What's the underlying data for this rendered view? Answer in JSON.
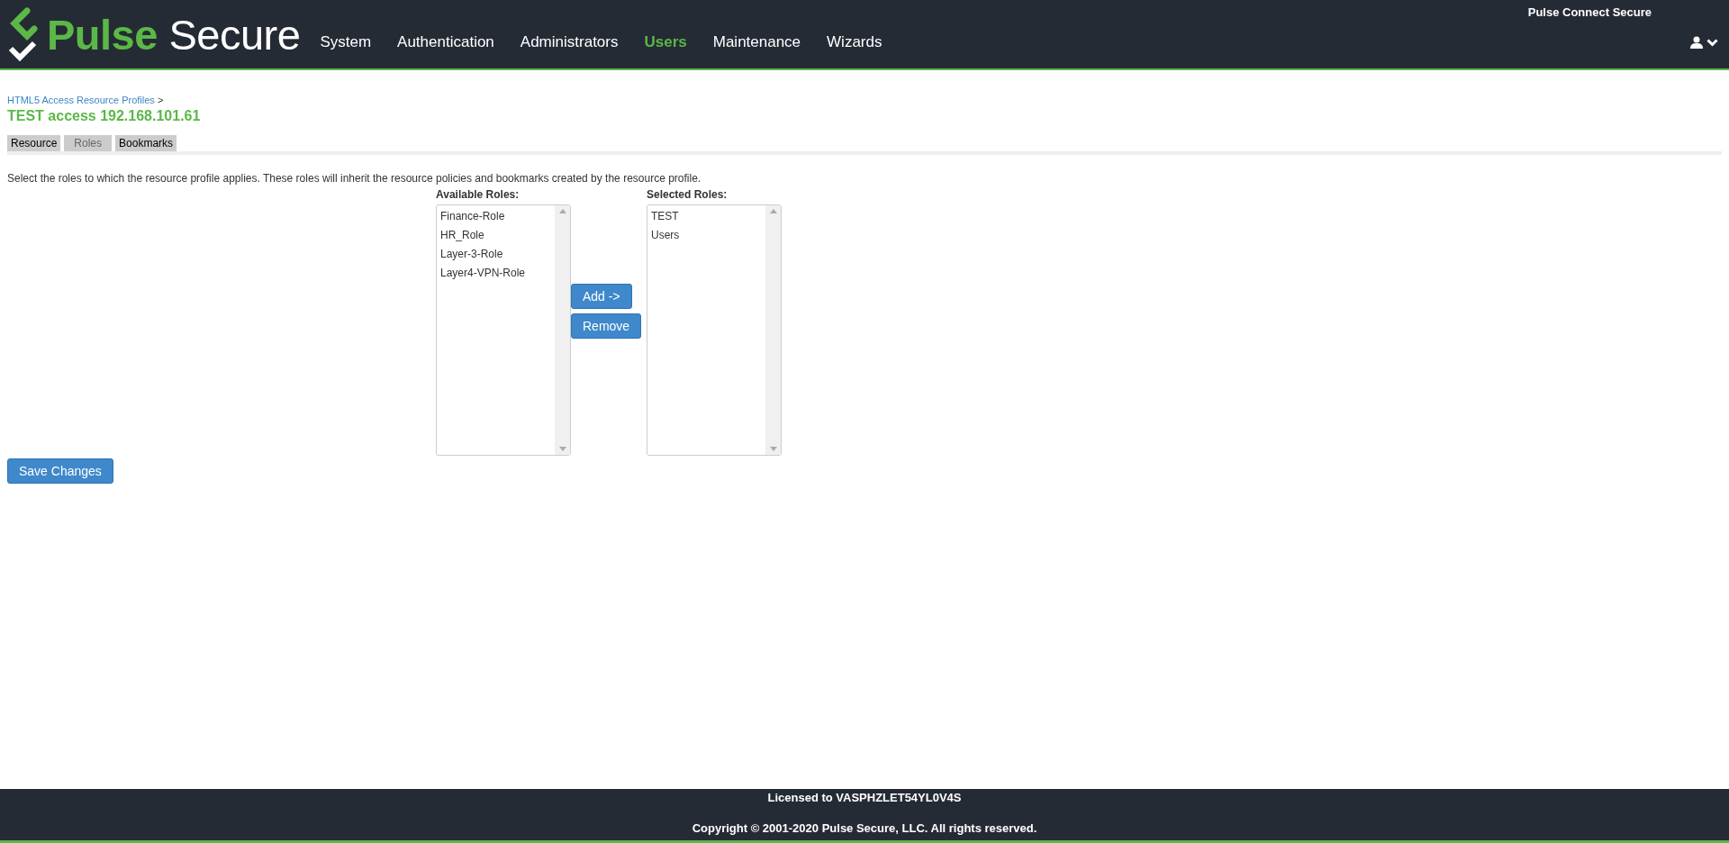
{
  "header": {
    "logo": [
      "Pulse",
      "Secure"
    ],
    "product": "Pulse Connect Secure",
    "nav": [
      {
        "label": "System",
        "selected": false
      },
      {
        "label": "Authentication",
        "selected": false
      },
      {
        "label": "Administrators",
        "selected": false
      },
      {
        "label": "Users",
        "selected": true
      },
      {
        "label": "Maintenance",
        "selected": false
      },
      {
        "label": "Wizards",
        "selected": false
      }
    ]
  },
  "breadcrumb": {
    "link": "HTML5 Access Resource Profiles",
    "separator": ">"
  },
  "title": "TEST access 192.168.101.61",
  "tabs": [
    {
      "label": "Resource",
      "selected": false
    },
    {
      "label": "Roles",
      "selected": true
    },
    {
      "label": "Bookmarks",
      "selected": false
    }
  ],
  "description": "Select the roles to which the resource profile applies. These roles will inherit the resource policies and bookmarks created by the resource profile.",
  "available_roles": {
    "label": "Available Roles:",
    "items": [
      "Finance-Role",
      "HR_Role",
      "Layer-3-Role",
      "Layer4-VPN-Role"
    ]
  },
  "selected_roles": {
    "label": "Selected Roles:",
    "items": [
      "TEST",
      "Users"
    ]
  },
  "buttons": {
    "add": "Add ->",
    "remove": "Remove",
    "save": "Save Changes"
  },
  "footer": {
    "license": "Licensed to VASPHZLET54YL0V4S",
    "copyright": "Copyright © 2001-2020 Pulse Secure, LLC. All rights reserved."
  }
}
